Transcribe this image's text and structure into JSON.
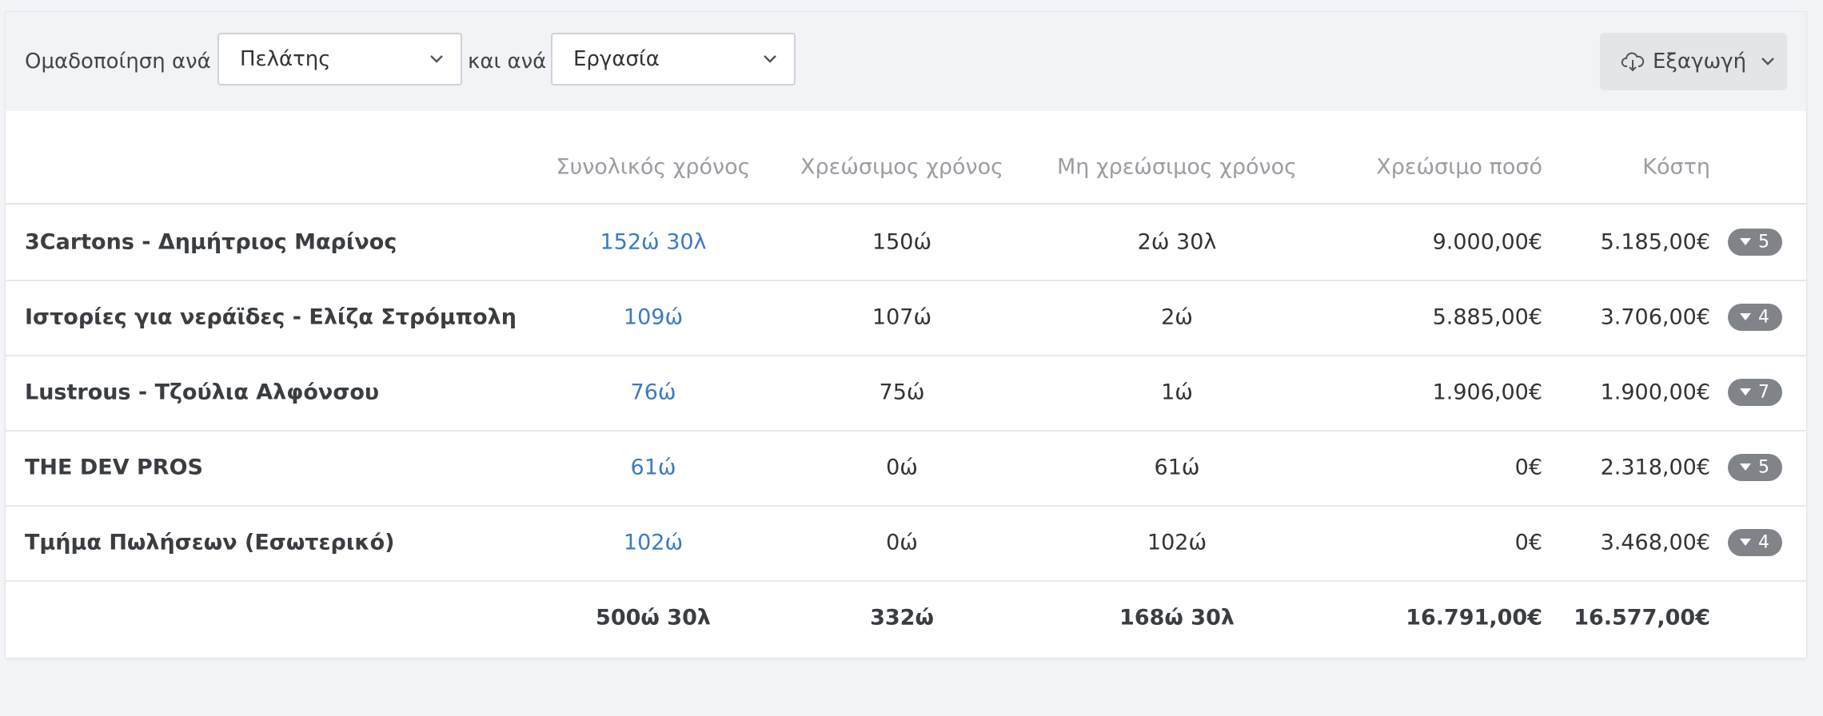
{
  "toolbar": {
    "group_by_label": "Ομαδοποίηση ανά",
    "group_by_value": "Πελάτης",
    "and_by_label": "και ανά",
    "and_by_value": "Εργασία",
    "export_label": "Εξαγωγή"
  },
  "table": {
    "headers": {
      "total_time": "Συνολικός χρόνος",
      "billable_time": "Χρεώσιμος χρόνος",
      "non_billable_time": "Μη χρεώσιμος χρόνος",
      "billable_amount": "Χρεώσιμο ποσό",
      "cost": "Κόστη"
    },
    "rows": [
      {
        "name": "3Cartons - Δημήτριος Μαρίνος",
        "total": "152ώ 30λ",
        "billable": "150ώ",
        "non_billable": "2ώ 30λ",
        "amount": "9.000,00€",
        "cost": "5.185,00€",
        "count": "5"
      },
      {
        "name": "Ιστορίες για νεράϊδες - Ελίζα Στρόμπολη",
        "total": "109ώ",
        "billable": "107ώ",
        "non_billable": "2ώ",
        "amount": "5.885,00€",
        "cost": "3.706,00€",
        "count": "4"
      },
      {
        "name": "Lustrous - Τζούλια Αλφόνσου",
        "total": "76ώ",
        "billable": "75ώ",
        "non_billable": "1ώ",
        "amount": "1.906,00€",
        "cost": "1.900,00€",
        "count": "7"
      },
      {
        "name": "THE DEV PROS",
        "total": "61ώ",
        "billable": "0ώ",
        "non_billable": "61ώ",
        "amount": "0€",
        "cost": "2.318,00€",
        "count": "5"
      },
      {
        "name": "Τμήμα Πωλήσεων (Εσωτερικό)",
        "total": "102ώ",
        "billable": "0ώ",
        "non_billable": "102ώ",
        "amount": "0€",
        "cost": "3.468,00€",
        "count": "4"
      }
    ],
    "totals": {
      "total": "500ώ 30λ",
      "billable": "332ώ",
      "non_billable": "168ώ 30λ",
      "amount": "16.791,00€",
      "cost": "16.577,00€"
    }
  },
  "icons": {
    "dropdown": "chevron-down-icon",
    "export": "cloud-download-icon",
    "expand": "caret-down-icon"
  },
  "colors": {
    "link": "#3b7ac4",
    "badge": "#808489",
    "toolbar_bg": "#f2f3f6"
  }
}
